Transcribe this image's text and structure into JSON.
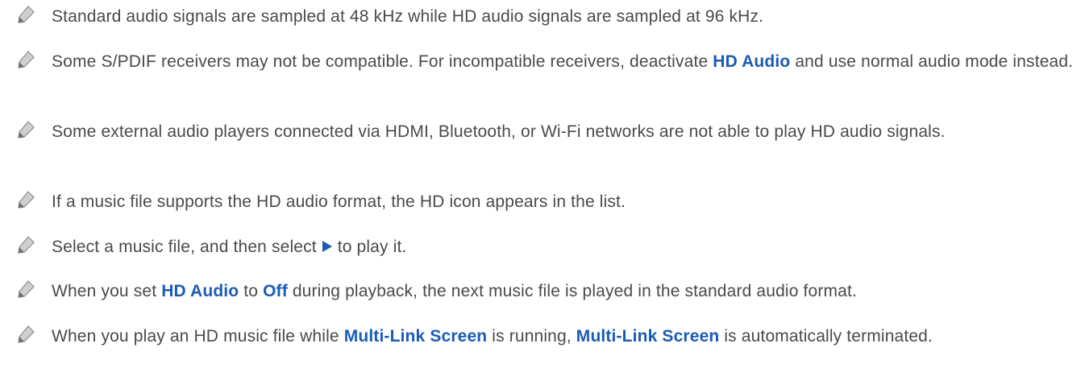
{
  "accent_color": "#1a5bb5",
  "text_color": "#4a4a4a",
  "icons": {
    "note": "pencil-note-icon",
    "play": "play-icon"
  },
  "notes": [
    {
      "text": "Standard audio signals are sampled at 48 kHz while HD audio signals are sampled at 96 kHz."
    },
    {
      "t1": "Some S/PDIF receivers may not be compatible. For incompatible receivers, deactivate ",
      "h1": "HD Audio",
      "t2": " and use normal audio mode instead."
    },
    {
      "text": "Some external audio players connected via HDMI, Bluetooth, or Wi-Fi networks are not able to play HD audio signals."
    },
    {
      "text": "If a music file supports the HD audio format, the HD icon appears in the list."
    },
    {
      "t1": "Select a music file, and then select ",
      "t2": " to play it."
    },
    {
      "t1": "When you set ",
      "h1": "HD Audio",
      "t2": " to ",
      "h2": "Off",
      "t3": " during playback, the next music file is played in the standard audio format."
    },
    {
      "t1": "When you play an HD music file while ",
      "h1": "Multi-Link Screen",
      "t2": " is running, ",
      "h2": "Multi-Link Screen",
      "t3": " is automatically terminated."
    }
  ]
}
